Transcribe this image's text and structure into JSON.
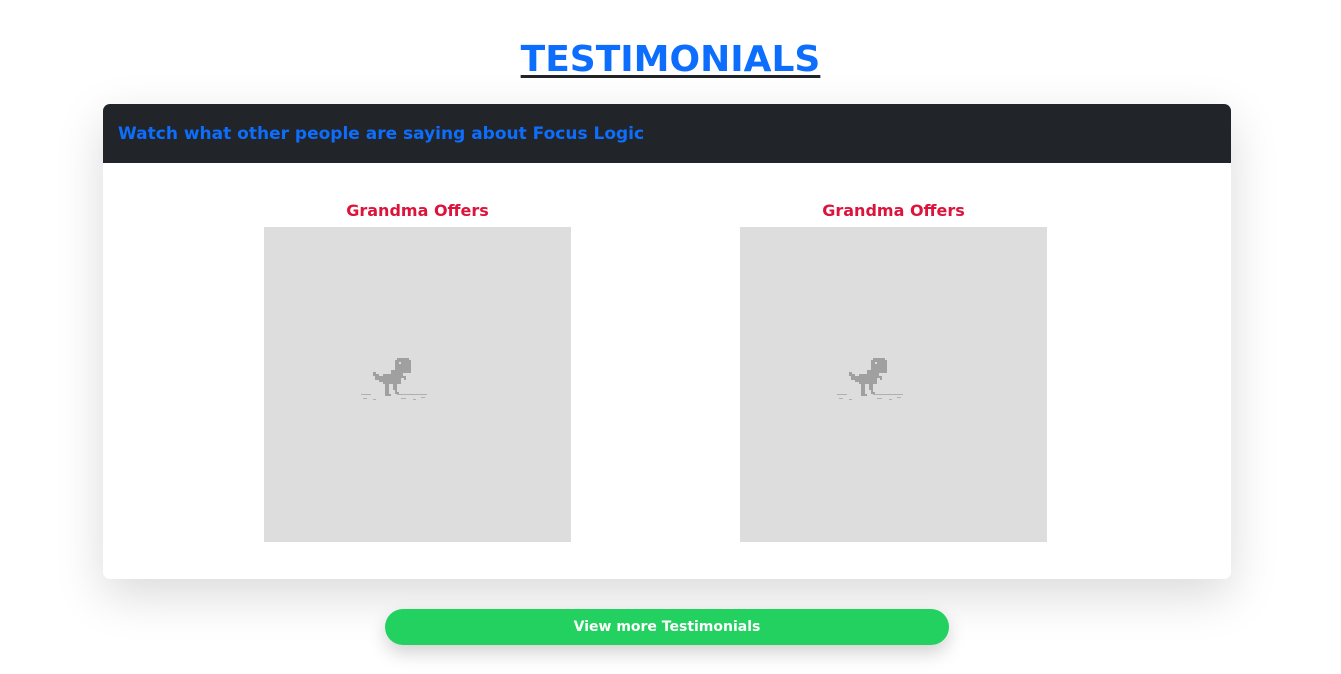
{
  "page": {
    "title": "TESTIMONIALS"
  },
  "card": {
    "header_text": "Watch what other people are saying about Focus Logic"
  },
  "videos": [
    {
      "title": "Grandma Offers",
      "icon": "dino-offline-icon"
    },
    {
      "title": "Grandma Offers",
      "icon": "dino-offline-icon"
    }
  ],
  "actions": {
    "view_more_label": "View more Testimonials"
  },
  "colors": {
    "title": "#0d6efd",
    "header_bg": "#212529",
    "header_text": "#0d6efd",
    "video_title": "#dc143c",
    "video_placeholder": "#dddddd",
    "button_bg": "#22d160",
    "button_text": "#ffffff"
  }
}
